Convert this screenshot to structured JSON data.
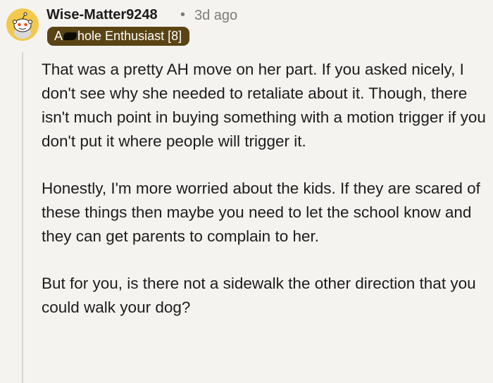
{
  "comment": {
    "author": {
      "username": "Wise-Matter9248",
      "avatar_icon": "snoo-avatar-icon",
      "avatar_color": "#f2c94c"
    },
    "separator": "•",
    "age": "3d ago",
    "flair": {
      "prefix": "A",
      "suffix": "hole Enthusiast [8]",
      "background": "#5a4414"
    },
    "paragraphs": [
      "That was a pretty AH move on her part. If you asked nicely, I don't see why she needed to retaliate about it. Though, there isn't much point in buying something with a motion trigger if you don't put it where people will trigger it.",
      "Honestly, I'm more worried about the kids. If they are scared of these things then maybe you need to let the school know and they can get parents to complain to her.",
      "But for you, is there not a sidewalk the other direction that you could walk your dog?"
    ]
  }
}
